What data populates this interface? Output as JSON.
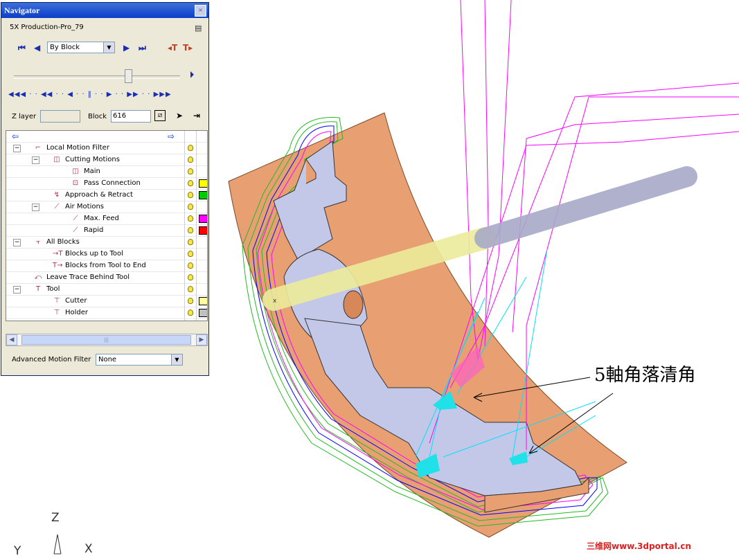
{
  "navigator": {
    "title": "Navigator",
    "close": "×",
    "project": "5X Production-Pro_79",
    "mode_select": "By Block",
    "z_layer_label": "Z layer",
    "z_layer_value": "",
    "block_label": "Block",
    "block_value": "616",
    "tree": [
      {
        "label": "Local Motion Filter",
        "depth": 0,
        "expander": "−",
        "icon": "filter-icon",
        "swatch": null
      },
      {
        "label": "Cutting Motions",
        "depth": 1,
        "expander": "−",
        "icon": "cutting-icon",
        "swatch": null
      },
      {
        "label": "Main",
        "depth": 2,
        "expander": null,
        "icon": "main-icon",
        "swatch": null
      },
      {
        "label": "Pass Connection",
        "depth": 2,
        "expander": null,
        "icon": "pass-icon",
        "swatch": "#ffff00"
      },
      {
        "label": "Approach & Retract",
        "depth": 1,
        "expander": null,
        "icon": "approach-icon",
        "swatch": "#00cc00"
      },
      {
        "label": "Air Motions",
        "depth": 1,
        "expander": "−",
        "icon": "air-icon",
        "swatch": null
      },
      {
        "label": "Max. Feed",
        "depth": 2,
        "expander": null,
        "icon": "maxfeed-icon",
        "swatch": "#ff00ff"
      },
      {
        "label": "Rapid",
        "depth": 2,
        "expander": null,
        "icon": "rapid-icon",
        "swatch": "#ff0000"
      },
      {
        "label": "All Blocks",
        "depth": 0,
        "expander": "−",
        "icon": "blocks-icon",
        "swatch": null
      },
      {
        "label": "Blocks up to Tool",
        "depth": 1,
        "expander": null,
        "icon": "blocks-up-icon",
        "swatch": null
      },
      {
        "label": "Blocks from Tool to End",
        "depth": 1,
        "expander": null,
        "icon": "blocks-end-icon",
        "swatch": null
      },
      {
        "label": "Leave Trace Behind Tool",
        "depth": 0,
        "expander": null,
        "icon": "trace-icon",
        "swatch": null
      },
      {
        "label": "Tool",
        "depth": 0,
        "expander": "−",
        "icon": "tool-icon",
        "swatch": null
      },
      {
        "label": "Cutter",
        "depth": 1,
        "expander": null,
        "icon": "cutter-icon",
        "swatch": "#ffffa0"
      },
      {
        "label": "Holder",
        "depth": 1,
        "expander": null,
        "icon": "holder-icon",
        "swatch": "#c0c0c0"
      }
    ],
    "advanced_label": "Advanced Motion Filter",
    "advanced_value": "None"
  },
  "annotation": "5軸角落清角",
  "watermark": "三维网www.3dportal.cn",
  "axes": {
    "z": "Z",
    "y": "Y",
    "x": "X"
  },
  "colors": {
    "part": "#c4c8e8",
    "surface": "#e8a072",
    "toolpath_air": "#ff00ff",
    "toolpath_cut": "#00ffff",
    "toolpath_approach": "#00cc00"
  }
}
